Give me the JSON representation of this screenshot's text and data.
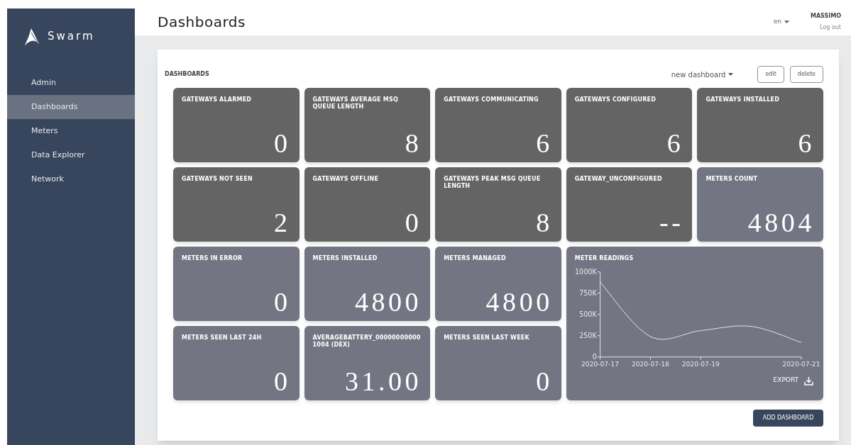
{
  "sidebar": {
    "brand": "Swarm",
    "items": [
      {
        "label": "Admin",
        "selected": false
      },
      {
        "label": "Dashboards",
        "selected": true
      },
      {
        "label": "Meters",
        "selected": false
      },
      {
        "label": "Data Explorer",
        "selected": false
      },
      {
        "label": "Network",
        "selected": false
      }
    ]
  },
  "header": {
    "title": "Dashboards",
    "language": "en",
    "user": "MASSIMO",
    "logout": "Log out"
  },
  "panel": {
    "title": "DASHBOARDS",
    "dashboard_select": "new dashboard",
    "buttons": [
      "edit",
      "delete"
    ],
    "tiles": [
      {
        "label": "GATEWAYS ALARMED",
        "value": "0",
        "color": "#646464"
      },
      {
        "label": "GATEWAYS AVERAGE MSQ QUEUE LENGTH",
        "value": "8",
        "color": "#646464"
      },
      {
        "label": "GATEWAYS COMMUNICATING",
        "value": "6",
        "color": "#646464"
      },
      {
        "label": "GATEWAYS CONFIGURED",
        "value": "6",
        "color": "#646464"
      },
      {
        "label": "GATEWAYS INSTALLED",
        "value": "6",
        "color": "#646464"
      },
      {
        "label": "GATEWAYS NOT SEEN",
        "value": "2",
        "color": "#646464"
      },
      {
        "label": "GATEWAYS OFFLINE",
        "value": "0",
        "color": "#646464"
      },
      {
        "label": "GATEWAYS PEAK MSG QUEUE LENGTH",
        "value": "8",
        "color": "#646464"
      },
      {
        "label": "GATEWAY_UNCONFIGURED",
        "value": "--",
        "color": "#646464"
      },
      {
        "label": "METERS COUNT",
        "value": "4804",
        "color": "#737682"
      },
      {
        "label": "METERS IN ERROR",
        "value": "0",
        "color": "#737682"
      },
      {
        "label": "METERS INSTALLED",
        "value": "4800",
        "color": "#737682"
      },
      {
        "label": "METERS MANAGED",
        "value": "4800",
        "color": "#737682"
      },
      {
        "label": "METERS SEEN LAST 24H",
        "value": "0",
        "color": "#737682"
      },
      {
        "label": "AVERAGEBATTERY_000000000001004 (DEX)",
        "value": "31.00",
        "color": "#737682"
      },
      {
        "label": "METERS SEEN LAST WEEK",
        "value": "0",
        "color": "#737682"
      }
    ],
    "chart_tile": {
      "title": "METER READINGS",
      "export": "EXPORT",
      "color": "#737682",
      "chart_data": {
        "type": "line",
        "categories": [
          "2020-07-17",
          "2020-07-18",
          "2020-07-19",
          null,
          "2020-07-21"
        ],
        "series": [
          {
            "color": "#e5e7eb",
            "values": [
              880000,
              240000,
              310000,
              360000,
              170000
            ]
          }
        ],
        "ylim": [
          0,
          1000000
        ],
        "yticks": [
          {
            "value": 0,
            "label": "0"
          },
          {
            "value": 250000,
            "label": "250K"
          },
          {
            "value": 500000,
            "label": "500K"
          },
          {
            "value": 750000,
            "label": "750K"
          },
          {
            "value": 1000000,
            "label": "1000K"
          }
        ]
      }
    },
    "add_button": "ADD DASHBOARD"
  }
}
